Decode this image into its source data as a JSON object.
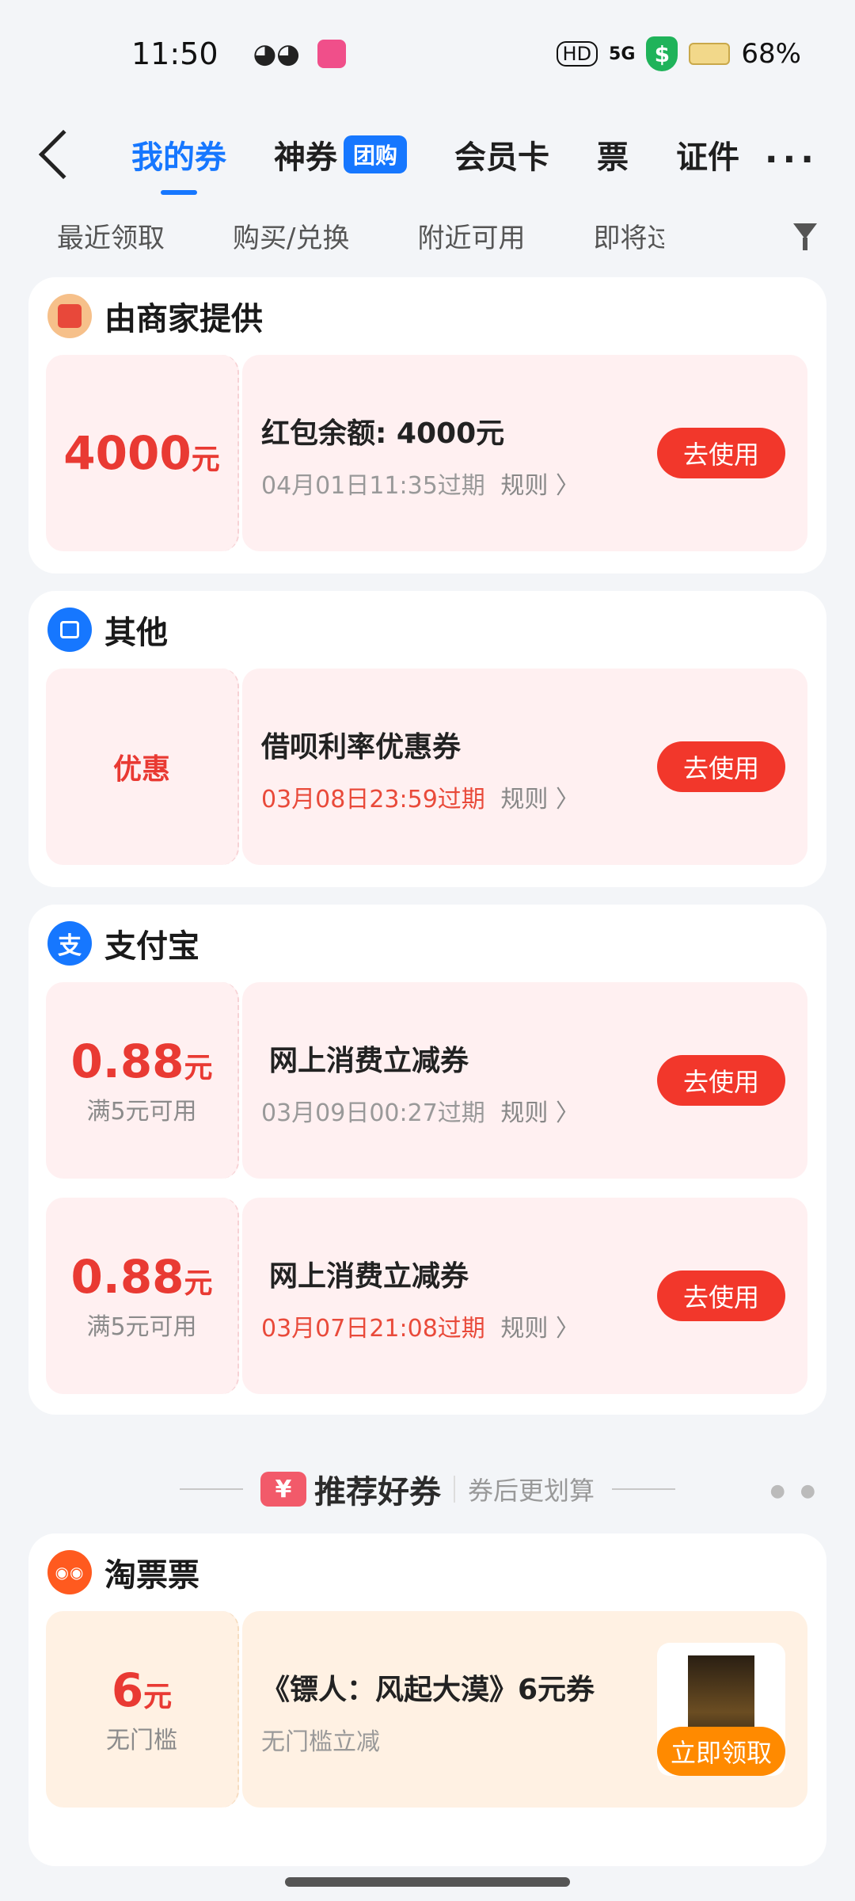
{
  "status_bar": {
    "time": "11:50",
    "network": "5G",
    "battery": "68%"
  },
  "nav": {
    "tabs": [
      "我的券",
      "神券",
      "会员卡",
      "票",
      "证件"
    ],
    "group_badge": "团购",
    "more_label": "···"
  },
  "filters": [
    "最近领取",
    "购买/兑换",
    "附近可用",
    "即将过期"
  ],
  "sections": {
    "merchant": {
      "title": "由商家提供",
      "coupon": {
        "amount": "4000",
        "unit": "元",
        "title": "红包余额: 4000元",
        "expiry": "04月01日11:35过期",
        "rule": "规则 〉",
        "button": "去使用"
      }
    },
    "other": {
      "title": "其他",
      "coupon": {
        "label": "优惠",
        "title": "借呗利率优惠券",
        "expiry": "03月08日23:59过期",
        "rule": "规则 〉",
        "button": "去使用"
      }
    },
    "alipay": {
      "title": "支付宝",
      "coupons": [
        {
          "amount": "0.88",
          "unit": "元",
          "condition": "满5元可用",
          "title": "网上消费立减券",
          "expiry": "03月09日00:27过期",
          "rule": "规则 〉",
          "button": "去使用"
        },
        {
          "amount": "0.88",
          "unit": "元",
          "condition": "满5元可用",
          "title": "网上消费立减券",
          "expiry": "03月07日21:08过期",
          "rule": "规则 〉",
          "button": "去使用"
        }
      ]
    }
  },
  "recommend": {
    "tag": "¥",
    "title": "推荐好券",
    "subtitle": "券后更划算",
    "card": {
      "title": "淘票票",
      "icon_text": "◉◉",
      "coupon": {
        "amount": "6",
        "unit": "元",
        "condition": "无门槛",
        "title": "《镖人：风起大漠》6元券",
        "desc": "无门槛立减",
        "button": "立即领取"
      }
    }
  },
  "icons": {
    "merchant": "red-envelope-icon",
    "other": "store-icon",
    "alipay": "alipay-logo-icon",
    "taopiaopiao": "taopiaopiao-logo-icon"
  },
  "colors": {
    "accent": "#1677ff",
    "red": "#f2372b",
    "orange": "#ff8a00"
  }
}
